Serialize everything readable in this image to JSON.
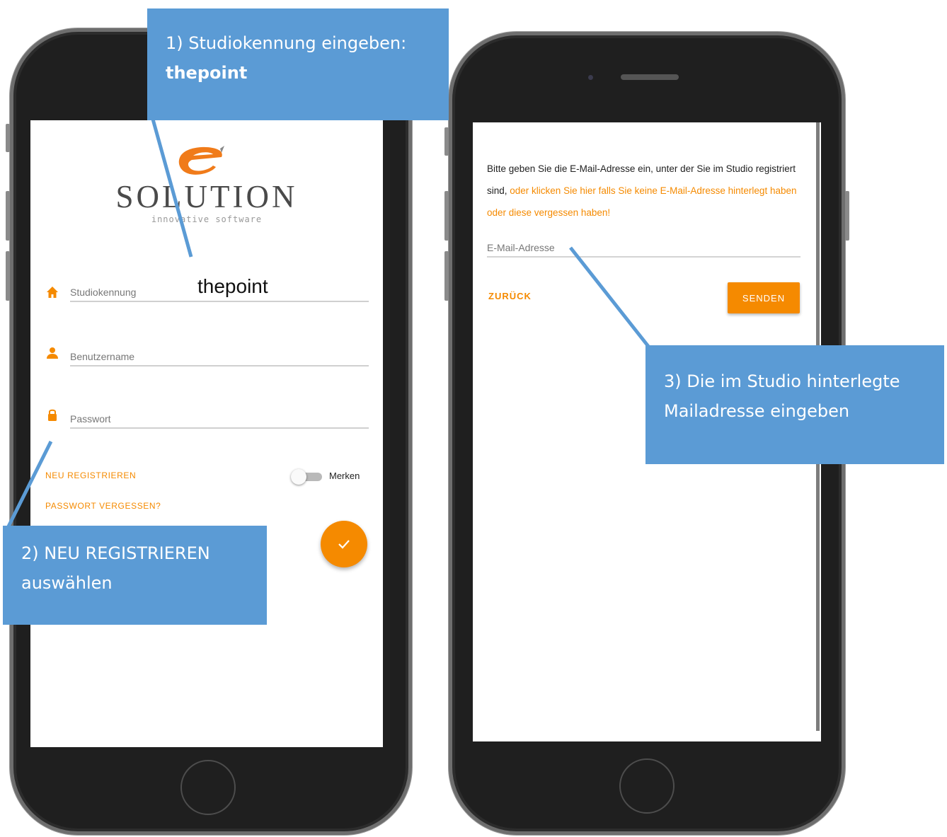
{
  "left_phone": {
    "logo": {
      "title": "SOLUTION",
      "tagline": "innovative software"
    },
    "fields": {
      "studio": {
        "label": "Studiokennung",
        "value": "thepoint",
        "icon": "home-icon"
      },
      "username": {
        "label": "Benutzername",
        "icon": "person-icon"
      },
      "password": {
        "label": "Passwort",
        "icon": "lock-icon"
      }
    },
    "register_link": "NEU REGISTRIEREN",
    "forgot_link": "PASSWORT VERGESSEN?",
    "remember_toggle": {
      "label": "Merken",
      "checked": false
    },
    "submit_button": {
      "icon": "check-icon"
    }
  },
  "right_phone": {
    "intro_text": "Bitte geben Sie die E-Mail-Adresse ein, unter der Sie im Studio registriert sind,",
    "intro_link": " oder klicken Sie hier falls Sie keine E-Mail-Adresse hinterlegt haben oder diese vergessen haben!",
    "email_placeholder": "E-Mail-Adresse",
    "back_button": "ZURÜCK",
    "send_button": "SENDEN"
  },
  "callouts": {
    "step1_text": "1) Studiokennung eingeben:",
    "step1_value": "thepoint",
    "step2_line1": "2) NEU REGISTRIEREN",
    "step2_line2": "auswählen",
    "step3_line1": "3) Die im Studio hinterlegte",
    "step3_line2": "Mailadresse eingeben"
  },
  "colors": {
    "accent": "#f58a00",
    "callout": "#5b9bd5",
    "phone_body": "#1f1f1f"
  }
}
